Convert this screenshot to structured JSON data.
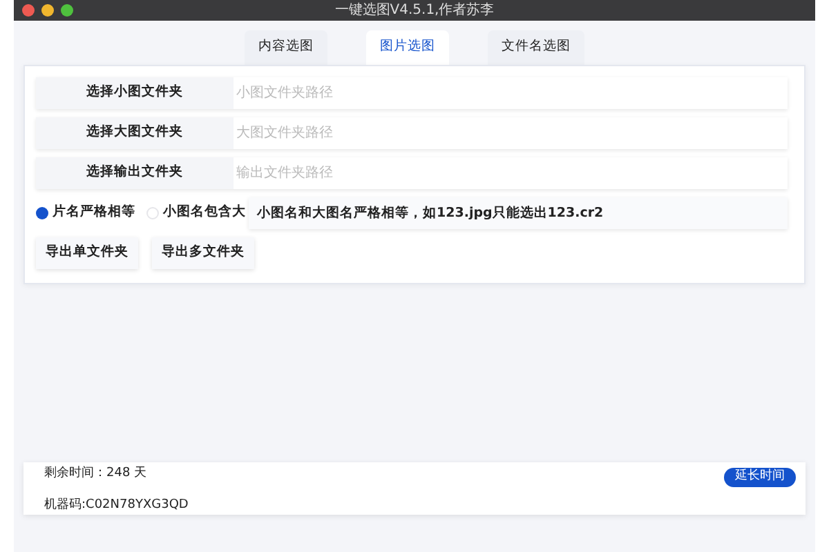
{
  "window": {
    "title": "一键选图V4.5.1,作者苏李"
  },
  "tabs": [
    {
      "label": "内容选图",
      "selected": false
    },
    {
      "label": "图片选图",
      "selected": true
    },
    {
      "label": "文件名选图",
      "selected": false
    }
  ],
  "folder_rows": [
    {
      "button": "选择小图文件夹",
      "placeholder": "小图文件夹路径"
    },
    {
      "button": "选择大图文件夹",
      "placeholder": "大图文件夹路径"
    },
    {
      "button": "选择输出文件夹",
      "placeholder": "输出文件夹路径"
    }
  ],
  "match_modes": [
    {
      "label": "片名严格相等",
      "selected": true
    },
    {
      "label": "小图名包含大",
      "selected": false
    }
  ],
  "mode_hint": "小图名和大图名严格相等，如123.jpg只能选出123.cr2",
  "export_buttons": [
    "导出单文件夹",
    "导出多文件夹"
  ],
  "footer": {
    "remaining": "剩余时间：248  天",
    "machine_code": "机器码:C02N78YXG3QD",
    "extend_button": "延长时间"
  }
}
